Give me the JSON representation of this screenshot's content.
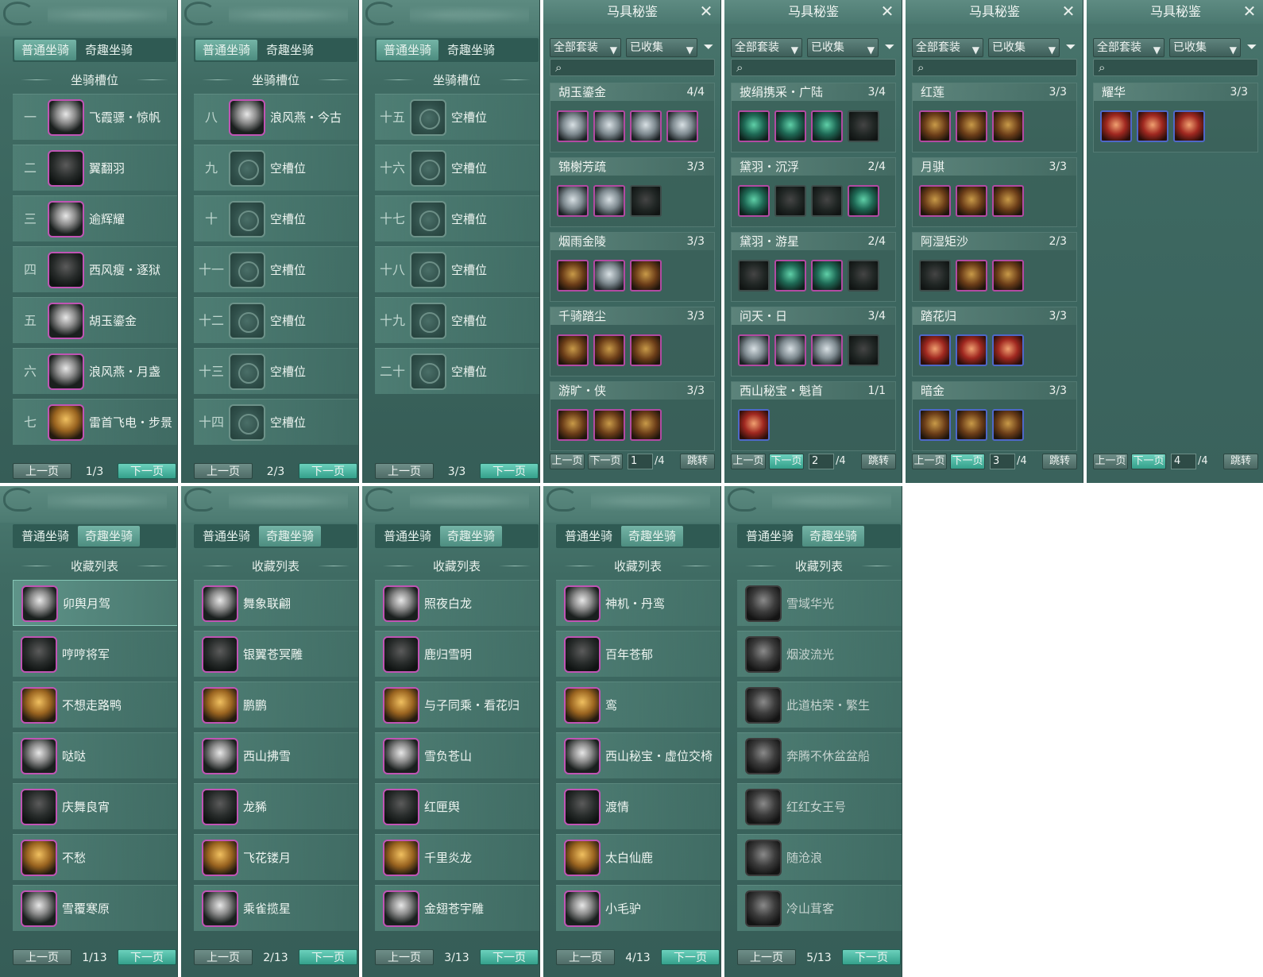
{
  "mount_tabs": {
    "normal": "普通坐骑",
    "fun": "奇趣坐骑"
  },
  "slot_title": "坐骑槽位",
  "collection_title": "收藏列表",
  "pager": {
    "prev": "上一页",
    "next": "下一页"
  },
  "slot_pages": [
    {
      "page": "1/3",
      "slots": [
        {
          "num": "一",
          "name": "飞霞骠・惊帆",
          "icon": "white-horse-icon"
        },
        {
          "num": "二",
          "name": "翼翻羽",
          "icon": "black-horse-icon"
        },
        {
          "num": "三",
          "name": "逾辉耀",
          "icon": "white-horse-icon"
        },
        {
          "num": "四",
          "name": "西风瘦・逐狱",
          "icon": "black-horse-icon"
        },
        {
          "num": "五",
          "name": "胡玉鎏金",
          "icon": "white-horse-icon"
        },
        {
          "num": "六",
          "name": "浪风燕・月盏",
          "icon": "white-horse-icon"
        },
        {
          "num": "七",
          "name": "雷首飞电・步景",
          "icon": "gold-horse-icon"
        }
      ]
    },
    {
      "page": "2/3",
      "slots": [
        {
          "num": "八",
          "name": "浪风燕・今古",
          "icon": "white-horse-icon"
        },
        {
          "num": "九",
          "name": "空槽位",
          "icon": "empty-slot-icon"
        },
        {
          "num": "十",
          "name": "空槽位",
          "icon": "empty-slot-icon"
        },
        {
          "num": "十一",
          "name": "空槽位",
          "icon": "empty-slot-icon"
        },
        {
          "num": "十二",
          "name": "空槽位",
          "icon": "empty-slot-icon"
        },
        {
          "num": "十三",
          "name": "空槽位",
          "icon": "empty-slot-icon"
        },
        {
          "num": "十四",
          "name": "空槽位",
          "icon": "empty-slot-icon"
        }
      ]
    },
    {
      "page": "3/3",
      "slots": [
        {
          "num": "十五",
          "name": "空槽位",
          "icon": "empty-slot-icon"
        },
        {
          "num": "十六",
          "name": "空槽位",
          "icon": "empty-slot-icon"
        },
        {
          "num": "十七",
          "name": "空槽位",
          "icon": "empty-slot-icon"
        },
        {
          "num": "十八",
          "name": "空槽位",
          "icon": "empty-slot-icon"
        },
        {
          "num": "十九",
          "name": "空槽位",
          "icon": "empty-slot-icon"
        },
        {
          "num": "二十",
          "name": "空槽位",
          "icon": "empty-slot-icon"
        }
      ]
    }
  ],
  "harness": {
    "title": "马具秘鉴",
    "filter_all": "全部套装",
    "filter_collected": "已收集",
    "jump": "跳转",
    "total": "/4",
    "pages": [
      {
        "page": "1",
        "sets": [
          {
            "name": "胡玉鎏金",
            "count": "4/4",
            "pieces": [
              "shadow-silver",
              "silver",
              "silver",
              "silver"
            ]
          },
          {
            "name": "锦榭芳疏",
            "count": "3/3",
            "pieces": [
              "shadow-silver",
              "silver",
              "shadow"
            ]
          },
          {
            "name": "烟雨金陵",
            "count": "3/3",
            "pieces": [
              "gold",
              "silver",
              "gold"
            ]
          },
          {
            "name": "千骑踏尘",
            "count": "3/3",
            "pieces": [
              "gold",
              "gold",
              "gold"
            ]
          },
          {
            "name": "游旷・侠",
            "count": "3/3",
            "pieces": [
              "gold",
              "gold",
              "gold"
            ]
          }
        ]
      },
      {
        "page": "2",
        "sets": [
          {
            "name": "披绢携采・广陆",
            "count": "3/4",
            "pieces": [
              "jade",
              "jade",
              "jade",
              "shadow"
            ]
          },
          {
            "name": "黛羽・沉浮",
            "count": "2/4",
            "pieces": [
              "jade",
              "shadow",
              "shadow",
              "jade"
            ]
          },
          {
            "name": "黛羽・游星",
            "count": "2/4",
            "pieces": [
              "shadow",
              "jade",
              "jade",
              "shadow"
            ]
          },
          {
            "name": "问天・日",
            "count": "3/4",
            "pieces": [
              "silver",
              "silver",
              "silver",
              "shadow"
            ]
          },
          {
            "name": "西山秘宝・魁首",
            "count": "1/1",
            "pieces": [
              "red"
            ]
          }
        ]
      },
      {
        "page": "3",
        "sets": [
          {
            "name": "红莲",
            "count": "3/3",
            "pieces": [
              "gold",
              "gold",
              "gold"
            ]
          },
          {
            "name": "月骐",
            "count": "3/3",
            "pieces": [
              "gold",
              "gold",
              "gold"
            ]
          },
          {
            "name": "阿湿矩沙",
            "count": "2/3",
            "pieces": [
              "shadow",
              "gold",
              "gold"
            ]
          },
          {
            "name": "踏花归",
            "count": "3/3",
            "pieces": [
              "red",
              "red",
              "red"
            ]
          },
          {
            "name": "暗金",
            "count": "3/3",
            "pieces": [
              "gold",
              "gold",
              "gold"
            ]
          }
        ]
      },
      {
        "page": "4",
        "sets": [
          {
            "name": "耀华",
            "count": "3/3",
            "pieces": [
              "red",
              "red",
              "red"
            ]
          }
        ]
      }
    ]
  },
  "collection_pages": [
    {
      "page": "1/13",
      "items": [
        "卯舆月驾",
        "哼哼将军",
        "不想走路鸭",
        "哒哒",
        "庆舞良宵",
        "不愁",
        "雪覆寒原"
      ]
    },
    {
      "page": "2/13",
      "items": [
        "舞象联翩",
        "银翼苍冥雕",
        "鹏鹏",
        "西山拂雪",
        "龙豨",
        "飞花镂月",
        "乘雀揽星"
      ]
    },
    {
      "page": "3/13",
      "items": [
        "照夜白龙",
        "鹿归雪明",
        "与子同乘・看花归",
        "雪负苍山",
        "红匣舆",
        "千里炎龙",
        "金翅苍宇雕"
      ]
    },
    {
      "page": "4/13",
      "items": [
        "神机・丹鸾",
        "百年苍郁",
        "鸾",
        "西山秘宝・虚位交椅",
        "渡情",
        "太白仙鹿",
        "小毛驴"
      ]
    },
    {
      "page": "5/13",
      "items": [
        "雪域华光",
        "烟波流光",
        "此道枯荣・繁生",
        "奔腾不休盆盆船",
        "红红女王号",
        "随沧浪",
        "冷山茸客"
      ]
    }
  ]
}
